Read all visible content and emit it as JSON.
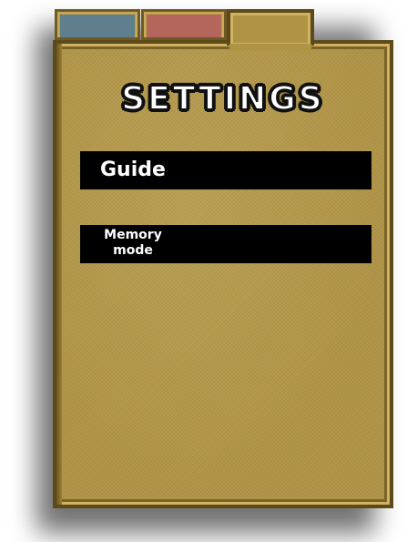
{
  "tabs": [
    {
      "color": "#5f7f8e",
      "state": "inactive"
    },
    {
      "color": "#b5665c",
      "state": "inactive"
    },
    {
      "color": "#b09446",
      "state": "active"
    }
  ],
  "panel": {
    "title": "SETTINGS",
    "buttons": [
      {
        "label": "Guide"
      },
      {
        "label": "Memory mode"
      }
    ]
  },
  "colors": {
    "panel": "#b09446",
    "border": "#5c4a1a",
    "button": "#000000",
    "text": "#ffffff"
  }
}
